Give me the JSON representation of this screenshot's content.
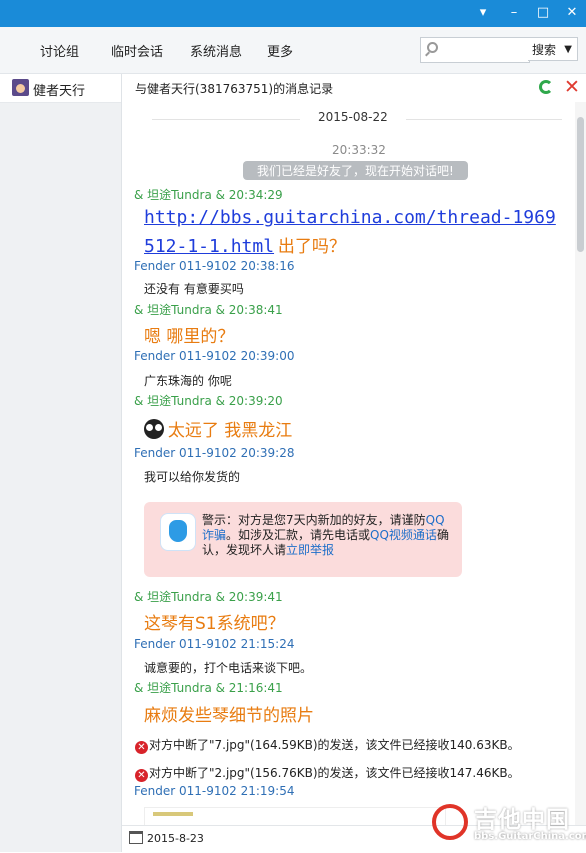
{
  "window": {
    "controls": [
      "▾",
      "–",
      "□",
      "✕"
    ]
  },
  "toolbar": {
    "items": [
      "讨论组",
      "临时会话",
      "系统消息",
      "更多"
    ],
    "search_placeholder": "",
    "search_label": "搜索"
  },
  "sidebar": {
    "contact_name": "健者天行"
  },
  "header": {
    "title": "与健者天行(381763751)的消息记录"
  },
  "history": {
    "date": "2015-08-22",
    "sys_time": "20:33:32",
    "sys_message": "我们已经是好友了，现在开始对话吧!",
    "entries": [
      {
        "meta": "& 坦途Tundra & 20:34:29"
      },
      {
        "link_line1": "http://bbs.guitarchina.com/thread-1969",
        "link_line2": "512-1-1.html",
        "text": "出了吗？"
      },
      {
        "meta": "Fender 011-9102  20:38:16"
      },
      {
        "text": "还没有  有意要买吗"
      },
      {
        "meta": "& 坦途Tundra & 20:38:41"
      },
      {
        "text": "嗯  哪里的？"
      },
      {
        "meta": "Fender 011-9102  20:39:00"
      },
      {
        "text": "广东珠海的 你呢"
      },
      {
        "meta": "& 坦途Tundra & 20:39:20"
      },
      {
        "text": "太远了   我黑龙江"
      },
      {
        "meta": "Fender 011-9102  20:39:28"
      },
      {
        "text": "我可以给你发货的"
      },
      {
        "meta": "& 坦途Tundra & 20:39:41"
      },
      {
        "text": "这琴有S1系统吧？"
      },
      {
        "meta": "Fender 011-9102  21:15:24"
      },
      {
        "text": "诚意要的，打个电话来谈下吧。"
      },
      {
        "meta": "& 坦途Tundra & 21:16:41"
      },
      {
        "text": "麻烦发些琴细节的照片"
      },
      {
        "text": "对方中断了\"7.jpg\"(164.59KB)的发送，该文件已经接收140.63KB。"
      },
      {
        "text": "对方中断了\"2.jpg\"(156.76KB)的发送，该文件已经接收147.46KB。"
      },
      {
        "meta": "Fender 011-9102  21:19:54"
      }
    ],
    "warning": {
      "part1": "警示：对方是您7天内新加的好友，请谨防",
      "link1": "QQ诈骗",
      "part2": "。如涉及汇款，请先电话或",
      "link2": "QQ视频通话",
      "part3": "确认，发现坏人请",
      "link3": "立即举报"
    }
  },
  "footer": {
    "date": "2015-8-23"
  },
  "watermark": {
    "cn": "吉他中国",
    "en": "bbs.GuitarChina.com"
  },
  "colors": {
    "titlebar": "#1a8bd8",
    "tundra": "#3aa04a",
    "fender": "#2f6fb5",
    "highlight": "#e87c11",
    "link": "#1f3ddb"
  }
}
